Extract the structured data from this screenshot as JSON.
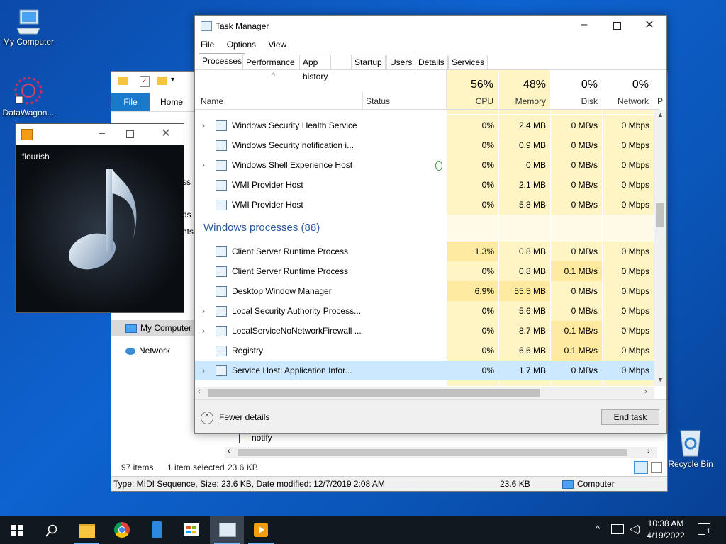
{
  "desktop": {
    "icons": [
      {
        "label": "My Computer"
      },
      {
        "label": "DataWagon..."
      },
      {
        "label": "Recycle Bin"
      }
    ]
  },
  "explorer": {
    "file_tab": "File",
    "home_tab": "Home",
    "nav_fragments": [
      "ss",
      "ds",
      "nts"
    ],
    "nav_my_computer": "My Computer",
    "nav_network": "Network",
    "file_row": "notify",
    "status_items": "97 items",
    "status_selected": "1 item selected",
    "status_size": "23.6 KB",
    "details_text": "Type: MIDI Sequence, Size: 23.6 KB, Date modified: 12/7/2019 2:08 AM",
    "details_size": "23.6 KB",
    "details_location": "Computer"
  },
  "music": {
    "track": "flourish"
  },
  "taskmanager": {
    "title": "Task Manager",
    "menu": [
      "File",
      "Options",
      "View"
    ],
    "tabs": [
      "Processes",
      "Performance",
      "App history",
      "Startup",
      "Users",
      "Details",
      "Services"
    ],
    "columns": {
      "name": "Name",
      "status": "Status",
      "cpu_pct": "56%",
      "cpu": "CPU",
      "mem_pct": "48%",
      "mem": "Memory",
      "disk_pct": "0%",
      "disk": "Disk",
      "net_pct": "0%",
      "net": "Network",
      "power": "P"
    },
    "rows_top": [
      {
        "name": "Windows Security Health Service",
        "expand": true,
        "cpu": "0%",
        "mem": "2.4 MB",
        "disk": "0 MB/s",
        "net": "0 Mbps"
      },
      {
        "name": "Windows Security notification i...",
        "expand": false,
        "cpu": "0%",
        "mem": "0.9 MB",
        "disk": "0 MB/s",
        "net": "0 Mbps"
      },
      {
        "name": "Windows Shell Experience Host",
        "expand": true,
        "cpu": "0%",
        "mem": "0 MB",
        "disk": "0 MB/s",
        "net": "0 Mbps"
      },
      {
        "name": "WMI Provider Host",
        "expand": false,
        "cpu": "0%",
        "mem": "2.1 MB",
        "disk": "0 MB/s",
        "net": "0 Mbps"
      },
      {
        "name": "WMI Provider Host",
        "expand": false,
        "cpu": "0%",
        "mem": "5.8 MB",
        "disk": "0 MB/s",
        "net": "0 Mbps"
      }
    ],
    "group_label": "Windows processes (88)",
    "rows_bottom": [
      {
        "name": "Client Server Runtime Process",
        "expand": false,
        "cpu": "1.3%",
        "mem": "0.8 MB",
        "disk": "0 MB/s",
        "net": "0 Mbps"
      },
      {
        "name": "Client Server Runtime Process",
        "expand": false,
        "cpu": "0%",
        "mem": "0.8 MB",
        "disk": "0.1 MB/s",
        "net": "0 Mbps"
      },
      {
        "name": "Desktop Window Manager",
        "expand": false,
        "cpu": "6.9%",
        "mem": "55.5 MB",
        "disk": "0 MB/s",
        "net": "0 Mbps"
      },
      {
        "name": "Local Security Authority Process...",
        "expand": true,
        "cpu": "0%",
        "mem": "5.6 MB",
        "disk": "0 MB/s",
        "net": "0 Mbps"
      },
      {
        "name": "LocalServiceNoNetworkFirewall ...",
        "expand": true,
        "cpu": "0%",
        "mem": "8.7 MB",
        "disk": "0.1 MB/s",
        "net": "0 Mbps"
      },
      {
        "name": "Registry",
        "expand": false,
        "cpu": "0%",
        "mem": "6.6 MB",
        "disk": "0.1 MB/s",
        "net": "0 Mbps"
      },
      {
        "name": "Service Host: Application Infor...",
        "expand": true,
        "cpu": "0%",
        "mem": "1.7 MB",
        "disk": "0 MB/s",
        "net": "0 Mbps",
        "selected": true
      }
    ],
    "fewer_details": "Fewer details",
    "end_task": "End task"
  },
  "taskbar": {
    "time": "10:38 AM",
    "date": "4/19/2022",
    "notification_count": "1"
  },
  "colors": {
    "heat_light": "#fff4c4",
    "heat_mid": "#ffeaa0",
    "selected_row": "#cce8ff",
    "accent": "#1979ca"
  }
}
